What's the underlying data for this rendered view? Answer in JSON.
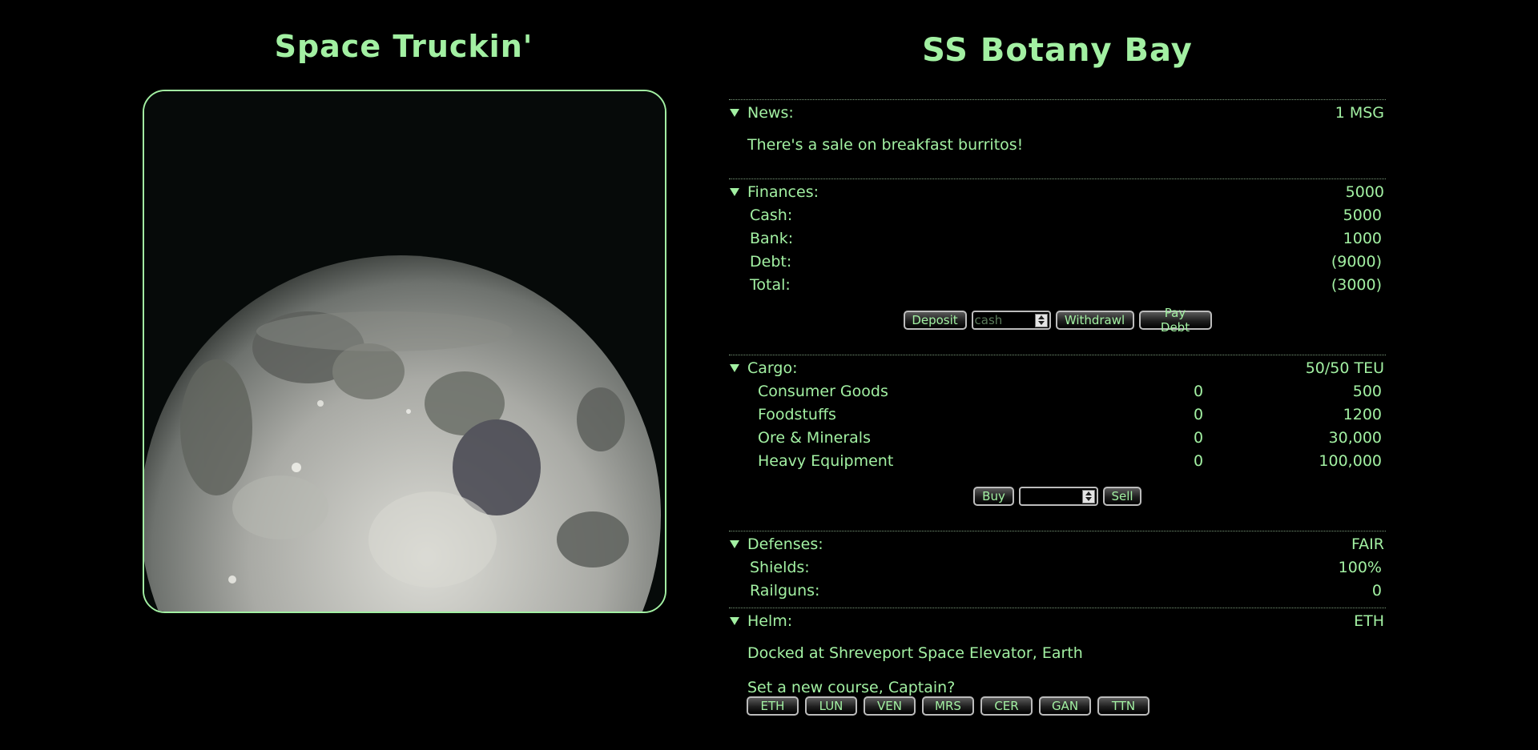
{
  "app": {
    "title": "Space Truckin'"
  },
  "ship": {
    "name": "SS Botany Bay"
  },
  "news": {
    "label": "News:",
    "summary": "1 MSG",
    "message": "There's a sale on breakfast burritos!"
  },
  "finances": {
    "label": "Finances:",
    "summary": "5000",
    "rows": [
      {
        "label": "Cash:",
        "value": "5000"
      },
      {
        "label": "Bank:",
        "value": "1000"
      },
      {
        "label": "Debt:",
        "value": "(9000)"
      },
      {
        "label": "Total:",
        "value": "(3000)"
      }
    ],
    "deposit_label": "Deposit",
    "amount_placeholder": "cash",
    "amount_value": "",
    "withdraw_label": "Withdrawl",
    "paydebt_label": "Pay Debt"
  },
  "cargo": {
    "label": "Cargo:",
    "summary": "50/50 TEU",
    "items": [
      {
        "name": "Consumer Goods",
        "qty": "0",
        "price": "500"
      },
      {
        "name": "Foodstuffs",
        "qty": "0",
        "price": "1200"
      },
      {
        "name": "Ore & Minerals",
        "qty": "0",
        "price": "30,000"
      },
      {
        "name": "Heavy Equipment",
        "qty": "0",
        "price": "100,000"
      }
    ],
    "buy_label": "Buy",
    "amount_value": "",
    "sell_label": "Sell"
  },
  "defenses": {
    "label": "Defenses:",
    "summary": "FAIR",
    "rows": [
      {
        "label": "Shields:",
        "value": "100%"
      },
      {
        "label": "Railguns:",
        "value": "0"
      }
    ]
  },
  "helm": {
    "label": "Helm:",
    "summary": "ETH",
    "status": "Docked at Shreveport Space Elevator, Earth",
    "prompt": "Set a new course, Captain?",
    "destinations": [
      "ETH",
      "LUN",
      "VEN",
      "MRS",
      "CER",
      "GAN",
      "TTN"
    ]
  },
  "colors": {
    "text": "#a2f0a2",
    "background": "#000000"
  },
  "icons": {
    "section_toggle": "triangle-down-icon",
    "planet_image": "moon-image"
  }
}
